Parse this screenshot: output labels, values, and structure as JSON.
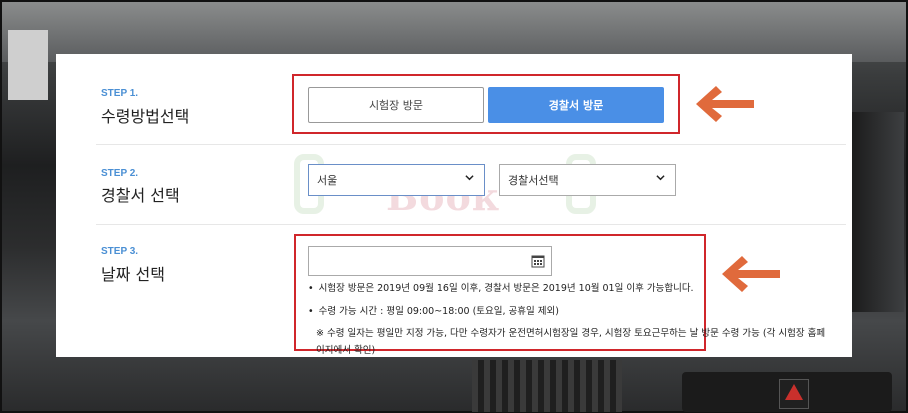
{
  "steps": [
    {
      "label": "STEP 1.",
      "title": "수령방법선택"
    },
    {
      "label": "STEP 2.",
      "title": "경찰서 선택"
    },
    {
      "label": "STEP 3.",
      "title": "날짜 선택"
    }
  ],
  "method": {
    "option1": "시험장 방문",
    "option2": "경찰서 방문",
    "selected": "경찰서 방문"
  },
  "police": {
    "region": "서울",
    "station": "경찰서선택"
  },
  "date": {
    "value": "",
    "note1": "시험장 방문은 2019년 09월 16일 이후, 경찰서 방문은 2019년 10월 01일 이후 가능합니다.",
    "note2": "수령 가능 시간 : 평일 09:00~18:00 (토요일, 공휴일 제외)",
    "note3_line1": "※ 수령 일자는 평일만 지정 가능, 다만 수령자가 운전면허시험장일 경우, 시험장 토요근무하는 날 방문 수령 가능 (각 시험장 홈페",
    "note3_line2": "이지에서 확인)"
  },
  "watermark": "Book",
  "colors": {
    "accent": "#4a8fe6",
    "highlight_box": "#d0262b",
    "arrow": "#e06a3c",
    "step_label": "#4a8fd4"
  },
  "icons": {
    "calendar": "calendar-icon",
    "chevron": "chevron-down-icon",
    "arrow": "arrow-left-icon"
  }
}
